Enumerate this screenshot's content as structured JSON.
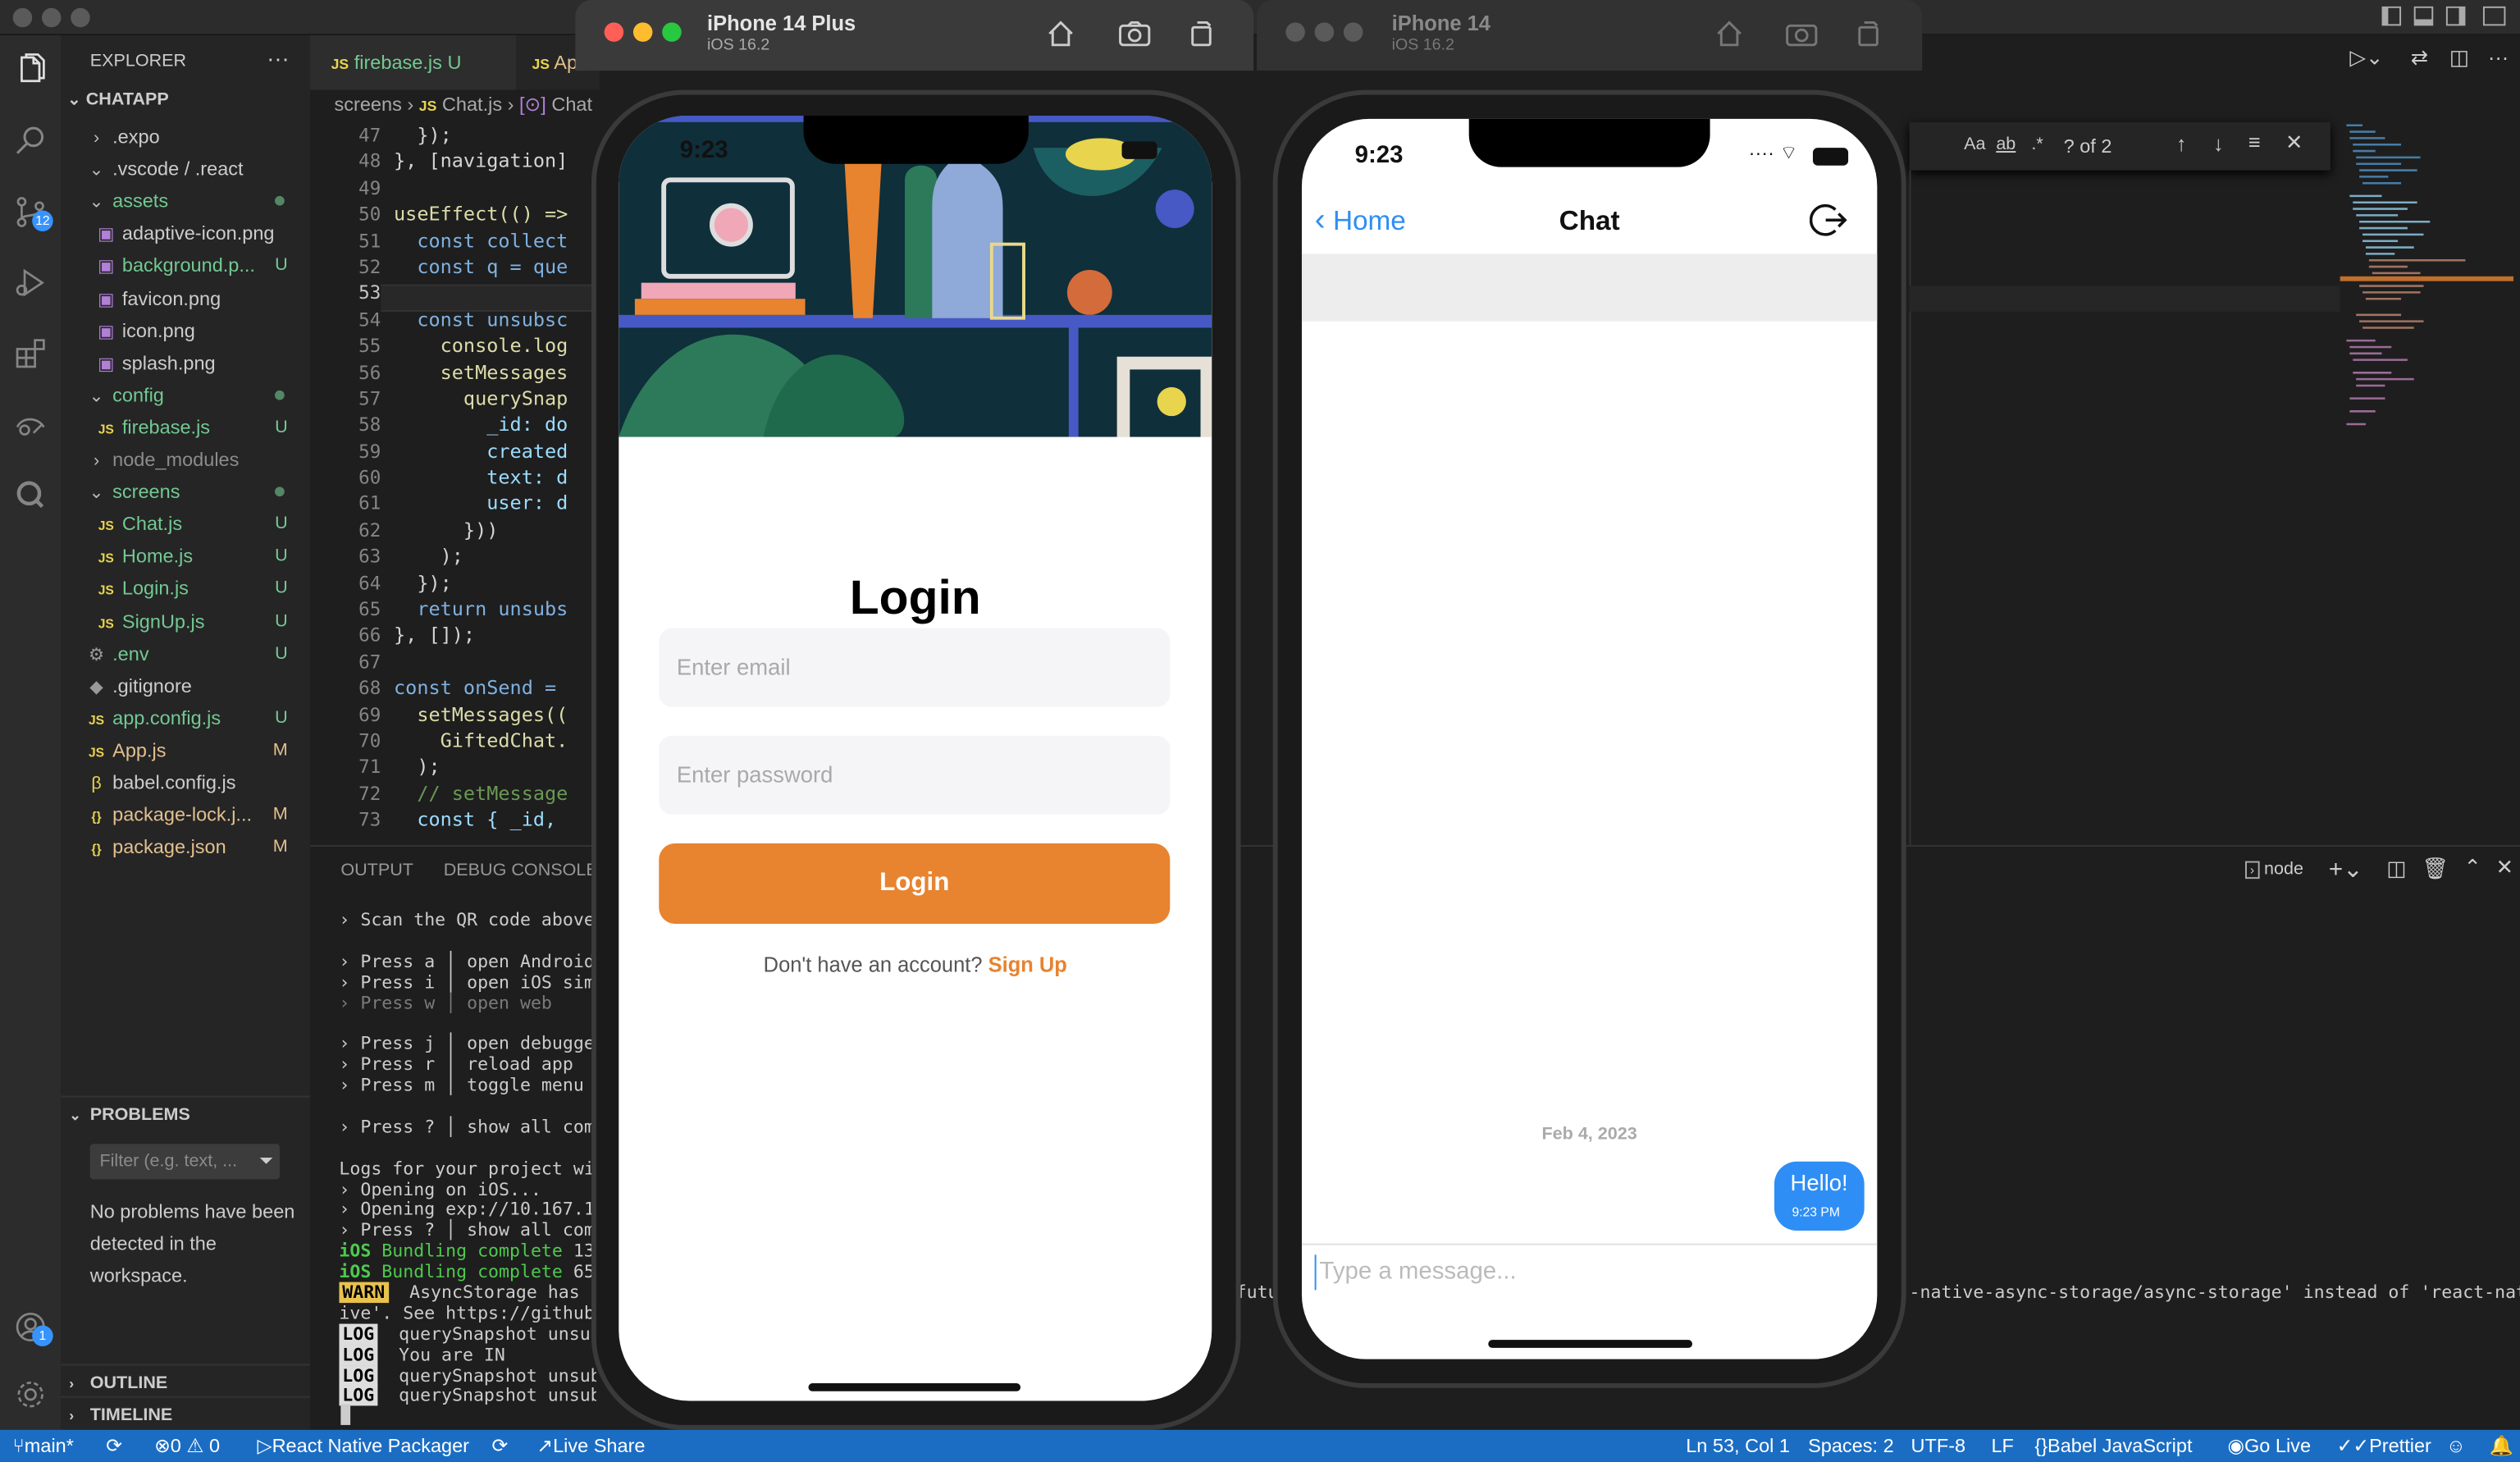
{
  "sidebar": {
    "title": "EXPLORER",
    "project": "CHATAPP",
    "tree": [
      {
        "label": ".expo",
        "depth": 1,
        "kind": "folder-closed",
        "flag": "",
        "color": "#cccccc"
      },
      {
        "label": ".vscode / .react",
        "depth": 1,
        "kind": "folder-open",
        "flag": "",
        "color": "#cccccc"
      },
      {
        "label": "assets",
        "depth": 1,
        "kind": "folder-open",
        "flag": "dot",
        "color": "#73c991"
      },
      {
        "label": "adaptive-icon.png",
        "depth": 2,
        "kind": "image",
        "flag": "",
        "color": "#cccccc"
      },
      {
        "label": "background.p...",
        "depth": 2,
        "kind": "image",
        "flag": "U",
        "color": "#73c991"
      },
      {
        "label": "favicon.png",
        "depth": 2,
        "kind": "image",
        "flag": "",
        "color": "#cccccc"
      },
      {
        "label": "icon.png",
        "depth": 2,
        "kind": "image",
        "flag": "",
        "color": "#cccccc"
      },
      {
        "label": "splash.png",
        "depth": 2,
        "kind": "image",
        "flag": "",
        "color": "#cccccc"
      },
      {
        "label": "config",
        "depth": 1,
        "kind": "folder-open",
        "flag": "dot",
        "color": "#73c991"
      },
      {
        "label": "firebase.js",
        "depth": 2,
        "kind": "js",
        "flag": "U",
        "color": "#73c991"
      },
      {
        "label": "node_modules",
        "depth": 1,
        "kind": "folder-closed",
        "flag": "",
        "color": "#8c8c8c"
      },
      {
        "label": "screens",
        "depth": 1,
        "kind": "folder-open",
        "flag": "dot",
        "color": "#73c991"
      },
      {
        "label": "Chat.js",
        "depth": 2,
        "kind": "js",
        "flag": "U",
        "color": "#73c991"
      },
      {
        "label": "Home.js",
        "depth": 2,
        "kind": "js",
        "flag": "U",
        "color": "#73c991"
      },
      {
        "label": "Login.js",
        "depth": 2,
        "kind": "js",
        "flag": "U",
        "color": "#73c991"
      },
      {
        "label": "SignUp.js",
        "depth": 2,
        "kind": "js",
        "flag": "U",
        "color": "#73c991"
      },
      {
        "label": ".env",
        "depth": 1,
        "kind": "gear",
        "flag": "U",
        "color": "#73c991"
      },
      {
        "label": ".gitignore",
        "depth": 1,
        "kind": "git",
        "flag": "",
        "color": "#cccccc"
      },
      {
        "label": "app.config.js",
        "depth": 1,
        "kind": "js",
        "flag": "U",
        "color": "#73c991"
      },
      {
        "label": "App.js",
        "depth": 1,
        "kind": "js",
        "flag": "M",
        "color": "#e2c08d"
      },
      {
        "label": "babel.config.js",
        "depth": 1,
        "kind": "babel",
        "flag": "",
        "color": "#cccccc"
      },
      {
        "label": "package-lock.j...",
        "depth": 1,
        "kind": "json",
        "flag": "M",
        "color": "#e2c08d"
      },
      {
        "label": "package.json",
        "depth": 1,
        "kind": "json",
        "flag": "M",
        "color": "#e2c08d"
      }
    ],
    "problems_title": "PROBLEMS",
    "filter_placeholder": "Filter (e.g. text, ...",
    "no_problems": "No problems have been detected in the workspace.",
    "outline": "OUTLINE",
    "timeline": "TIMELINE"
  },
  "activity": {
    "scm_badge": "12",
    "accounts_badge": "1"
  },
  "tabs": [
    {
      "label": "firebase.js",
      "flag": "U"
    },
    {
      "label": "Ap",
      "flag": ""
    }
  ],
  "breadcrumb": {
    "folder": "screens",
    "file": "Chat.js",
    "symbol": "Chat"
  },
  "editor": {
    "lines": [
      {
        "n": "47",
        "t": "  });"
      },
      {
        "n": "48",
        "t": "}, [navigation]"
      },
      {
        "n": "49",
        "t": ""
      },
      {
        "n": "50",
        "t": "useEffect(() =>"
      },
      {
        "n": "51",
        "t": "  const collect"
      },
      {
        "n": "52",
        "t": "  const q = que"
      },
      {
        "n": "53",
        "t": ""
      },
      {
        "n": "54",
        "t": "  const unsubsc"
      },
      {
        "n": "55",
        "t": "    console.log"
      },
      {
        "n": "56",
        "t": "    setMessages"
      },
      {
        "n": "57",
        "t": "      querySnap"
      },
      {
        "n": "58",
        "t": "        _id: do"
      },
      {
        "n": "59",
        "t": "        created"
      },
      {
        "n": "60",
        "t": "        text: d"
      },
      {
        "n": "61",
        "t": "        user: d"
      },
      {
        "n": "62",
        "t": "      }))"
      },
      {
        "n": "63",
        "t": "    );"
      },
      {
        "n": "64",
        "t": "  });"
      },
      {
        "n": "65",
        "t": "  return unsubs"
      },
      {
        "n": "66",
        "t": "}, []);"
      },
      {
        "n": "67",
        "t": ""
      },
      {
        "n": "68",
        "t": "const onSend ="
      },
      {
        "n": "69",
        "t": "  setMessages(("
      },
      {
        "n": "70",
        "t": "    GiftedChat."
      },
      {
        "n": "71",
        "t": "  );"
      },
      {
        "n": "72",
        "t": "  // setMessage"
      },
      {
        "n": "73",
        "t": "  const { _id,"
      }
    ]
  },
  "find": {
    "count": "? of 2",
    "opt1": "Aa",
    "opt2": "ab",
    "opt3": ".*"
  },
  "panel": {
    "tab_output": "OUTPUT",
    "tab_debug": "DEBUG CONSOLE",
    "terminal_name": "node",
    "terminal_lines": [
      {
        "tag": "",
        "t": "› Scan the QR code above"
      },
      {
        "tag": "",
        "t": ""
      },
      {
        "tag": "",
        "t": "› Press a │ open Android"
      },
      {
        "tag": "",
        "t": "› Press i │ open iOS sim"
      },
      {
        "tag": "dim",
        "t": "› Press w │ open web"
      },
      {
        "tag": "",
        "t": ""
      },
      {
        "tag": "",
        "t": "› Press j │ open debugge"
      },
      {
        "tag": "",
        "t": "› Press r │ reload app"
      },
      {
        "tag": "",
        "t": "› Press m │ toggle menu"
      },
      {
        "tag": "",
        "t": ""
      },
      {
        "tag": "",
        "t": "› Press ? │ show all com"
      },
      {
        "tag": "",
        "t": ""
      },
      {
        "tag": "",
        "t": "Logs for your project wi"
      },
      {
        "tag": "",
        "t": "› Opening on iOS..."
      },
      {
        "tag": "",
        "t": "› Opening exp://10.167.1"
      },
      {
        "tag": "",
        "t": "› Press ? │ show all com"
      },
      {
        "tag": "ios",
        "t": "iOS Bundling complete 13"
      },
      {
        "tag": "ios",
        "t": "iOS Bundling complete 65"
      },
      {
        "tag": "warn",
        "t": "WARN  AsyncStorage has"
      },
      {
        "tag": "",
        "t": "ive'. See https://github"
      },
      {
        "tag": "log",
        "t": "LOG  querySnapshot unsub"
      },
      {
        "tag": "log",
        "t": "LOG  You are IN"
      },
      {
        "tag": "log",
        "t": "LOG  querySnapshot unsub"
      },
      {
        "tag": "log",
        "t": "LOG  querySnapshot unsub"
      }
    ],
    "right_frag": "futu",
    "right_warn": "-native-async-storage/async-storage' instead of 'react-nat"
  },
  "sim1": {
    "name": "iPhone 14 Plus",
    "os": "iOS 16.2",
    "time": "9:23",
    "title": "Login",
    "email_placeholder": "Enter email",
    "password_placeholder": "Enter password",
    "button": "Login",
    "signup_prompt": "Don't have an account?",
    "signup_link": "Sign Up",
    "accent": "#e8832f"
  },
  "sim2": {
    "name": "iPhone 14",
    "os": "iOS 16.2",
    "time": "9:23",
    "back": "Home",
    "title": "Chat",
    "date": "Feb 4, 2023",
    "bubble_text": "Hello!",
    "bubble_time": "9:23 PM",
    "bubble_color": "#2e8ef5",
    "input_placeholder": "Type a message..."
  },
  "status": {
    "branch": "main*",
    "problems": "0 ⚠ 0",
    "packager": "React Native Packager",
    "liveshare": "Live Share",
    "position": "Ln 53, Col 1",
    "spaces": "Spaces: 2",
    "encoding": "UTF-8",
    "eol": "LF",
    "language": "Babel JavaScript",
    "golive": "Go Live",
    "prettier": "Prettier",
    "color": "#1b6dc4"
  }
}
